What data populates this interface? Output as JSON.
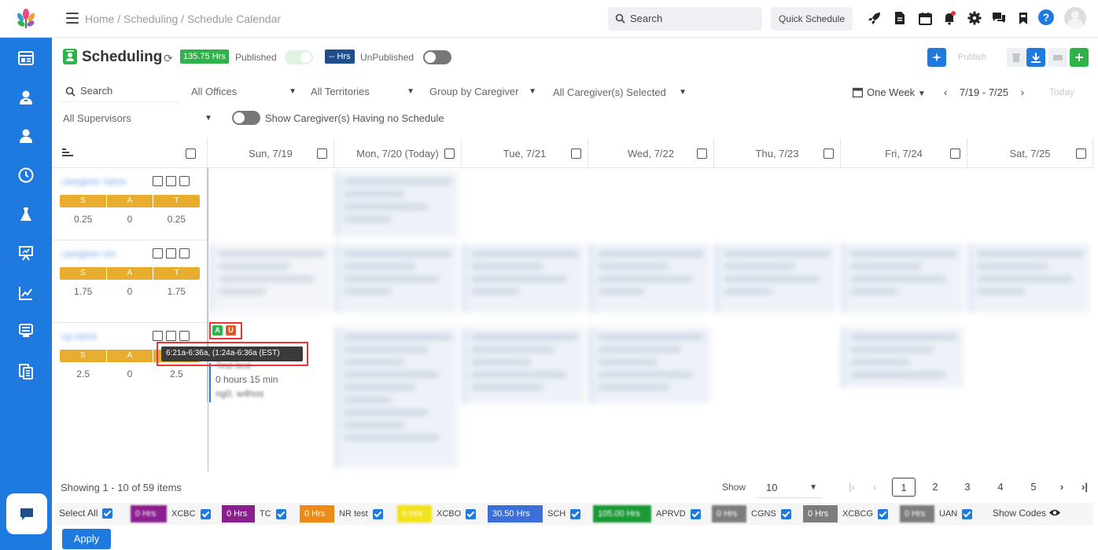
{
  "breadcrumb": "Home / Scheduling / Schedule Calendar",
  "search": {
    "placeholder": "Search"
  },
  "quick_schedule": "Quick Schedule",
  "page": {
    "title": "Scheduling",
    "published_hours": "135.75 Hrs",
    "published_label": "Published",
    "unpublished_hours": "-- Hrs",
    "unpublished_label": "UnPublished",
    "publish_button": "Publish"
  },
  "filters": {
    "search_placeholder": "Search",
    "offices": "All Offices",
    "territories": "All Territories",
    "group_by": "Group by Caregiver",
    "caregivers": "All Caregiver(s) Selected",
    "supervisors": "All Supervisors",
    "show_no_schedule": "Show Caregiver(s) Having no Schedule",
    "view": "One Week",
    "range": "7/19 - 7/25",
    "today": "Today"
  },
  "days": [
    "Sun, 7/19",
    "Mon, 7/20 (Today)",
    "Tue, 7/21",
    "Wed, 7/22",
    "Thu, 7/23",
    "Fri, 7/24",
    "Sat, 7/25"
  ],
  "sat_labels": [
    "S",
    "A",
    "T"
  ],
  "caregivers": [
    {
      "values": [
        "0.25",
        "0",
        "0.25"
      ]
    },
    {
      "values": [
        "1.75",
        "0",
        "1.75"
      ]
    },
    {
      "values": [
        "2.5",
        "0",
        "2.5"
      ]
    }
  ],
  "visit": {
    "badge_a": "A",
    "badge_u": "U",
    "tooltip": "6:21a-6:36a, (1:24a-6:36a (EST)",
    "line1": "Test test",
    "duration": "0 hours 15 min",
    "line3": "ng0, w4hos"
  },
  "footer": {
    "showing": "Showing 1 - 10 of 59 items",
    "show_label": "Show",
    "page_size": "10",
    "pages": [
      "1",
      "2",
      "3",
      "4",
      "5"
    ],
    "select_all": "Select All",
    "show_codes": "Show Codes",
    "apply": "Apply"
  },
  "codes": [
    {
      "hrs": "0 Hrs",
      "name": "XCBC",
      "color": "#8b1f8f"
    },
    {
      "hrs": "0 Hrs",
      "name": "TC",
      "color": "#8b1f8f"
    },
    {
      "hrs": "0 Hrs",
      "name": "NR test",
      "color": "#f08a16"
    },
    {
      "hrs": "0 Hrs",
      "name": "XCBO",
      "color": "#f2e21b"
    },
    {
      "hrs": "30.50 Hrs",
      "name": "SCH",
      "color": "#3c6fd8"
    },
    {
      "hrs": "105.00 Hrs",
      "name": "APRVD",
      "color": "#1a9a35"
    },
    {
      "hrs": "0 Hrs",
      "name": "CGNS",
      "color": "#7d7d7d"
    },
    {
      "hrs": "0 Hrs",
      "name": "XCBCG",
      "color": "#7d7d7d"
    },
    {
      "hrs": "0 Hrs",
      "name": "UAN",
      "color": "#7d7d7d"
    }
  ]
}
